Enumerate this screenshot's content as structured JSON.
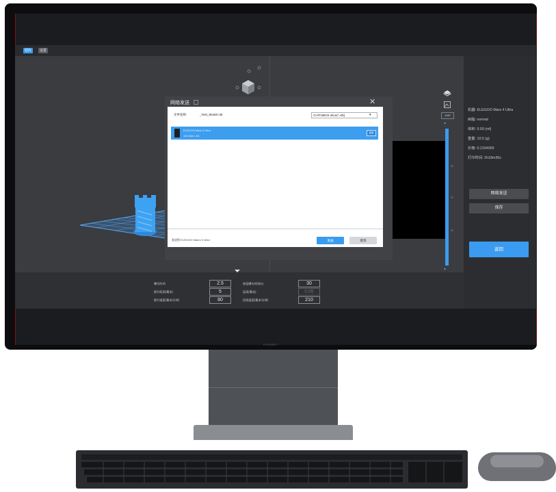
{
  "app": {
    "tabs": [
      {
        "label": "切片",
        "active": true
      },
      {
        "label": "设置",
        "active": false
      }
    ],
    "layer_field": "1287",
    "slider_ticks": [
      "¾",
      "½",
      "¼"
    ]
  },
  "printer_info": {
    "machine": "机器:  ELEGOO Mars 4 Ultra",
    "resin": "树脂:  normal",
    "volume": "体积:  9.59 (ml)",
    "weight": "重量:  10.5 (g)",
    "price": "价格:  0.2164005",
    "print_time": "打印时间:  2h18m36s"
  },
  "right_buttons": {
    "network_send": "网络发送",
    "save": "保存",
    "back": "返回"
  },
  "params": [
    {
      "label": "曝光时间",
      "value": "2.5"
    },
    {
      "label": "底层曝光时间(s)",
      "value": "30"
    },
    {
      "label": "提升距离(毫米)",
      "value": "5"
    },
    {
      "label": "层高(毫米)",
      "value": "0.05"
    },
    {
      "label": "提升速度(毫米/分钟)",
      "value": "80"
    },
    {
      "label": "回程速度(毫米/分钟)",
      "value": "210"
    }
  ],
  "dialog": {
    "title": "网络发送",
    "file_label": "文件名称:",
    "filename": "_Test_Model.ctb",
    "filetype": "CHITUBOX slice(*.ctb)",
    "device_name": "ELEGOO Mars 4 Ultra",
    "device_ip": "192.168.1.63",
    "row_badge": "连接",
    "footer_status": "发送到 ELEGOO Saturn 3 Ultra",
    "send_button": "发送",
    "cancel_button": "取消"
  },
  "monitor_brand": "HUAWEI",
  "colors": {
    "accent": "#3b9bf0",
    "model_blue": "#3da2f2",
    "app_bg": "#333538",
    "dialog_frame": "#404246"
  }
}
